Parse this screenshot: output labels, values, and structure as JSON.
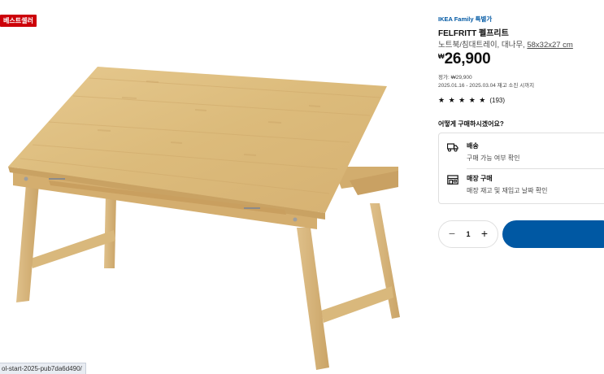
{
  "badge": {
    "label": "베스트셀러"
  },
  "product": {
    "family_label": "IKEA Family 특별가",
    "name": "FELFRITT 펠프리트",
    "description": "노트북/침대트레이, 대나무,",
    "dimensions": "58x32x27 cm",
    "price_currency": "₩",
    "price_amount": "26,900",
    "regular_price": "정가: ₩29,900",
    "offer_period": "2025.01.16 - 2025.03.04 재고 소진 시까지",
    "rating_value": 4.5,
    "rating_stars": "★ ★ ★ ★ ★",
    "review_count": "(193)"
  },
  "purchase": {
    "question": "어떻게 구매하시겠어요?",
    "delivery": {
      "title": "배송",
      "subtitle": "구매 가능 여부 확인",
      "icon": "truck-icon"
    },
    "store": {
      "title": "매장 구매",
      "subtitle": "매장 재고 및 재입고 날짜 확인",
      "icon": "store-icon"
    }
  },
  "quantity": {
    "value": "1",
    "minus": "−",
    "plus": "+"
  },
  "status_url": "ol-start-2025-pub7da6d490/",
  "colors": {
    "badge": "#cc0008",
    "accent": "#0058a3",
    "wood": "#e3c48a"
  }
}
